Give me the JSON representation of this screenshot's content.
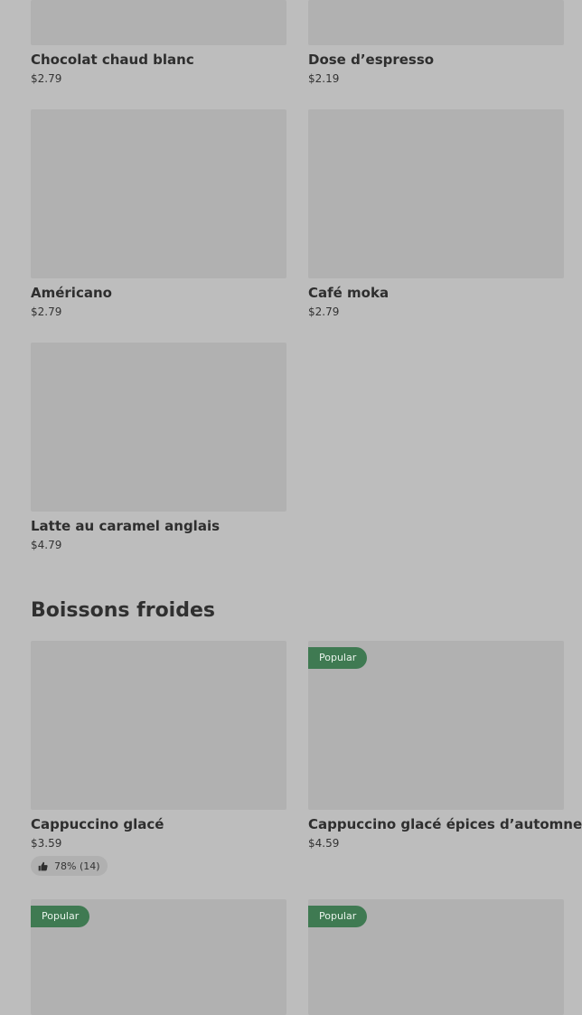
{
  "hot_drinks": [
    {
      "name": "Chocolat chaud blanc",
      "price": "$2.79"
    },
    {
      "name": "Dose d’espresso",
      "price": "$2.19"
    },
    {
      "name": "Américano",
      "price": "$2.79"
    },
    {
      "name": "Café moka",
      "price": "$2.79"
    },
    {
      "name": "Latte au caramel anglais",
      "price": "$4.79"
    }
  ],
  "cold_section": {
    "title": "Boissons froides"
  },
  "cold_drinks": [
    {
      "name": "Cappuccino glacé",
      "price": "$3.59",
      "rating": "78% (14)"
    },
    {
      "name": "Cappuccino glacé épices d’automne",
      "price": "$4.59",
      "badge": "Popular"
    },
    {
      "badge": "Popular"
    },
    {
      "badge": "Popular"
    }
  ],
  "icons": {
    "thumbs_up": "thumbs-up-icon"
  },
  "colors": {
    "background": "#bdbdbd",
    "image_placeholder": "#b1b1b1",
    "badge": "#3f7a52"
  }
}
